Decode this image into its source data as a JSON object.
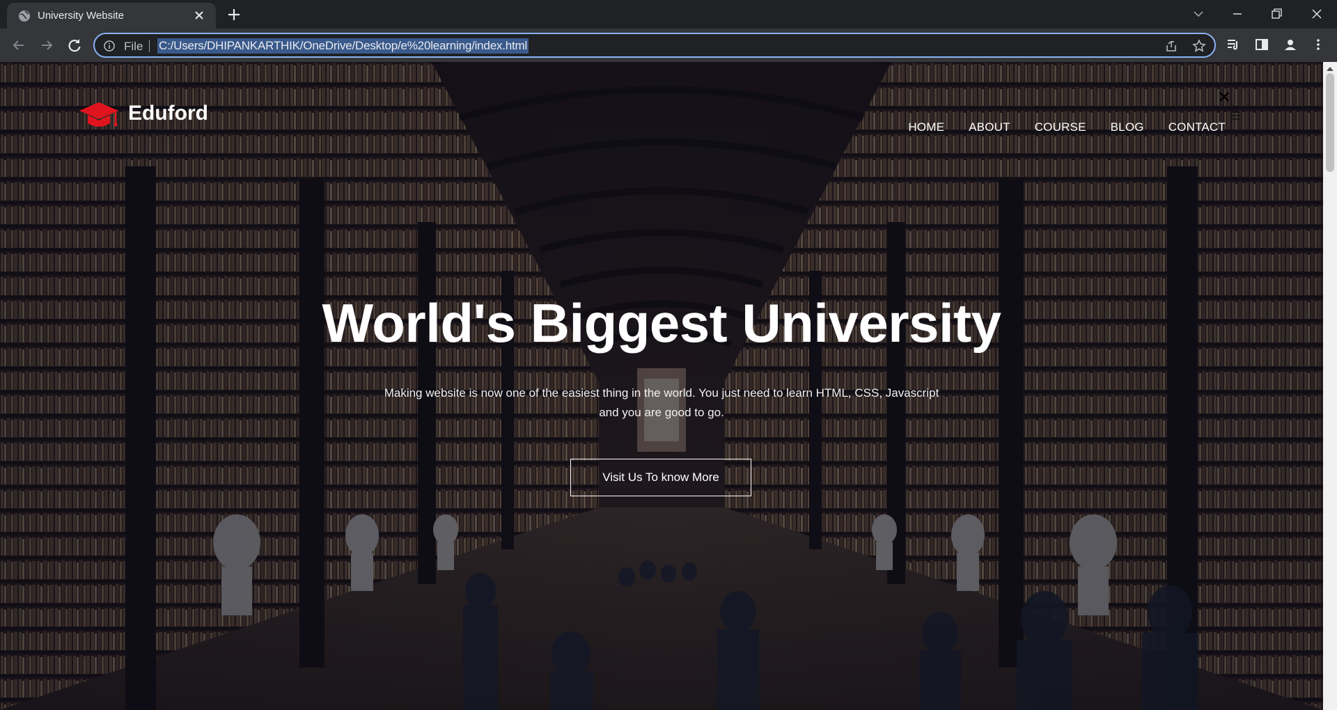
{
  "browser": {
    "tab_title": "University Website",
    "omnibox_file_label": "File",
    "url": "C:/Users/DHIPANKARTHIK/OneDrive/Desktop/e%20learning/index.html"
  },
  "site": {
    "brand": "Eduford",
    "brand_color": "#e0141e",
    "nav": [
      "HOME",
      "ABOUT",
      "COURSE",
      "BLOG",
      "CONTACT"
    ],
    "hero": {
      "title": "World's Biggest University",
      "subtitle": "Making website is now one of the easiest thing in the world. You just need to learn HTML, CSS, Javascript and you are good to go.",
      "cta": "Visit Us To know More"
    }
  }
}
